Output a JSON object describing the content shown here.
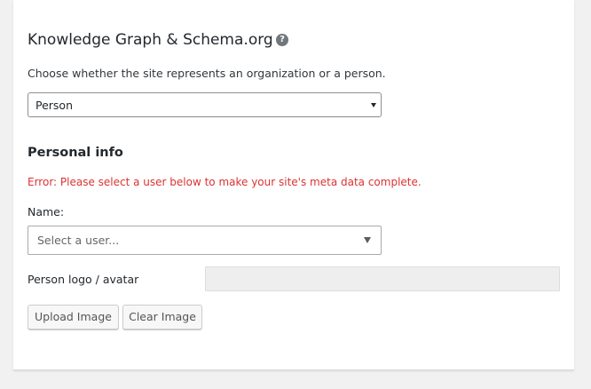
{
  "section": {
    "title": "Knowledge Graph & Schema.org",
    "help_icon": "question-circle-icon",
    "help_glyph": "?",
    "description": "Choose whether the site represents an organization or a person."
  },
  "type_select": {
    "selected": "Person"
  },
  "personal_info": {
    "heading": "Personal info",
    "error": "Error: Please select a user below to make your site's meta data complete.",
    "error_color": "#dc3232",
    "name_label": "Name:",
    "user_select_placeholder": "Select a user...",
    "logo_label": "Person logo / avatar",
    "logo_value": "",
    "upload_button": "Upload Image",
    "clear_button": "Clear Image"
  }
}
